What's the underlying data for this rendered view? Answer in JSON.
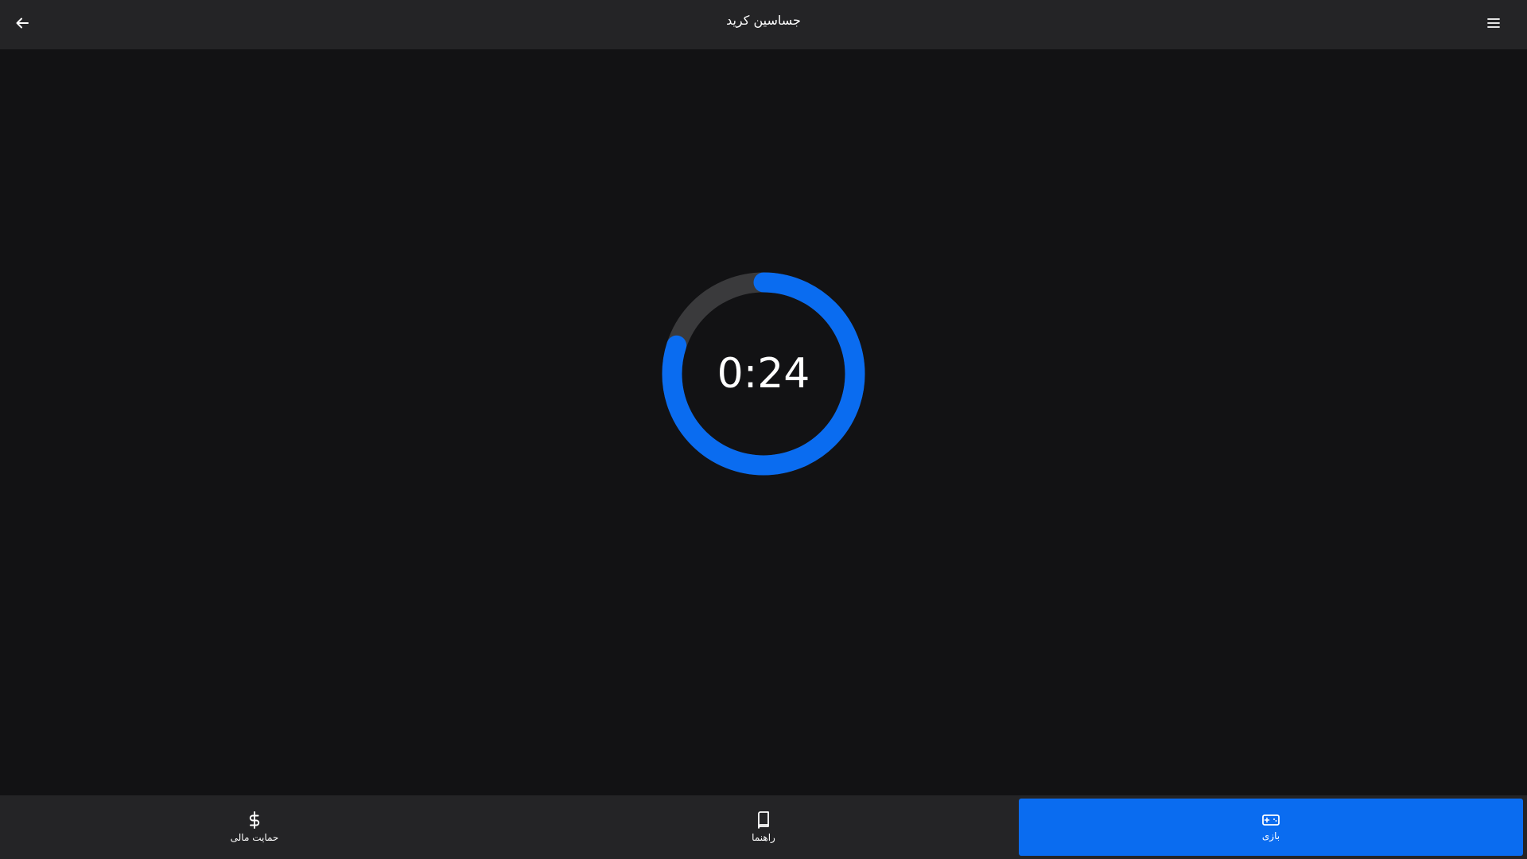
{
  "header": {
    "title": "جساسین کرید",
    "back_icon": "arrow-left-icon",
    "menu_icon": "hamburger-menu-icon"
  },
  "timer": {
    "time_text": "0:24",
    "progress_fraction": 0.8,
    "progress_color": "#0a6cf0",
    "track_color": "#3a3a3c"
  },
  "bottom_nav": {
    "items": [
      {
        "label": "حمایت مالی",
        "icon": "dollar-icon",
        "active": false
      },
      {
        "label": "راهنما",
        "icon": "book-icon",
        "active": false
      },
      {
        "label": "بازی",
        "icon": "gamepad-icon",
        "active": true
      }
    ],
    "active_color": "#0a6cf0"
  }
}
